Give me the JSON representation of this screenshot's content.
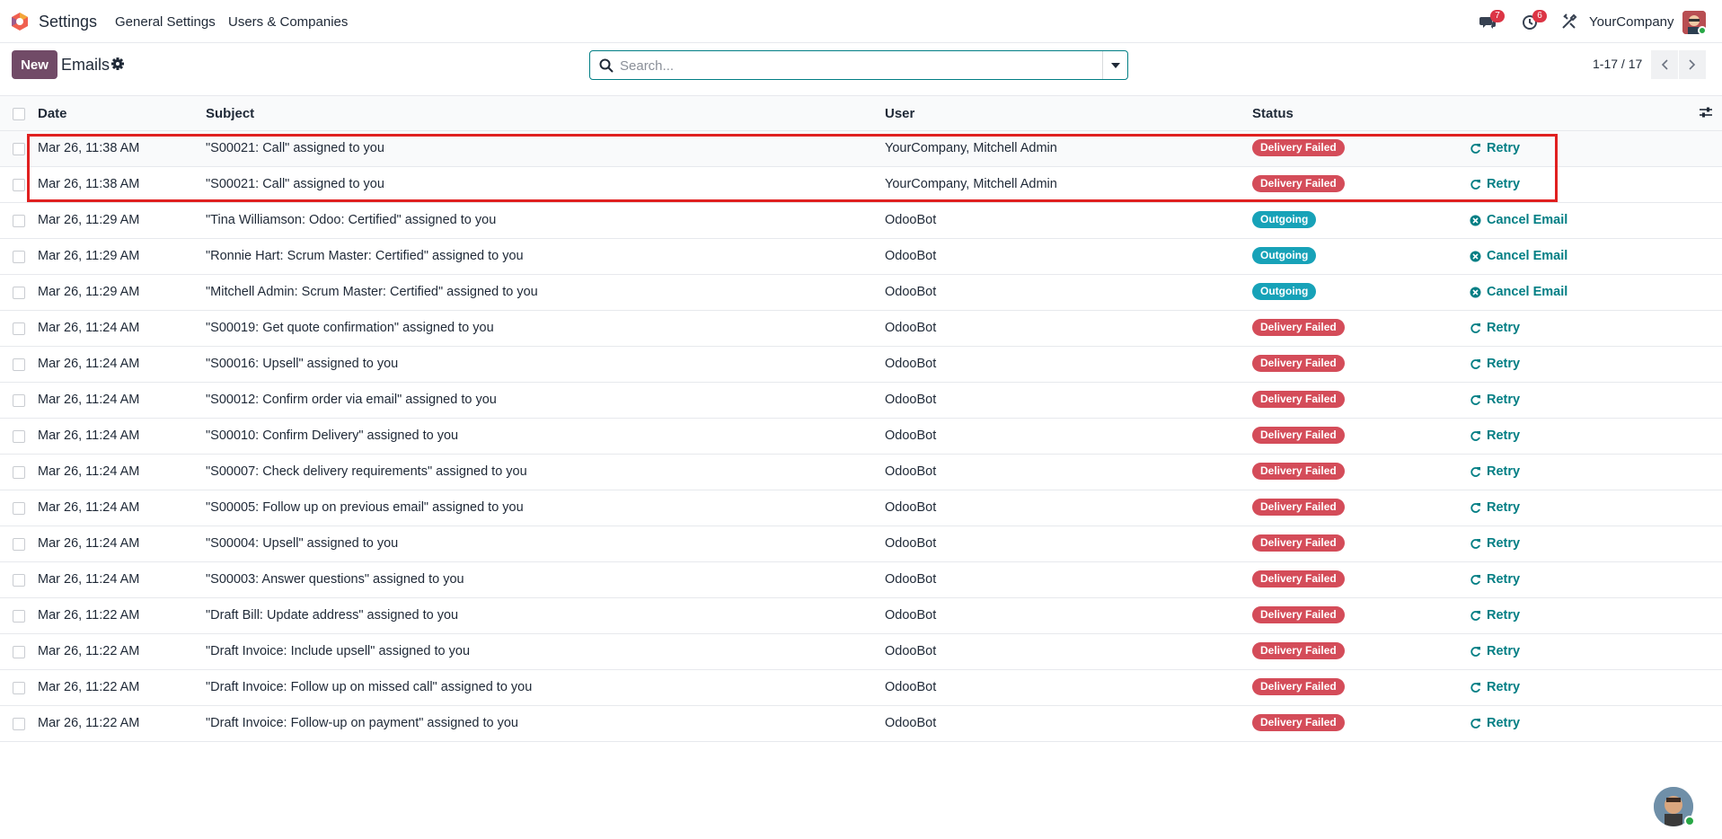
{
  "navbar": {
    "app_name": "Settings",
    "menu": [
      "General Settings",
      "Users & Companies"
    ],
    "messages_count": "7",
    "activities_count": "6",
    "company": "YourCompany"
  },
  "control": {
    "new_label": "New",
    "title": "Emails",
    "search_placeholder": "Search...",
    "pager": "1-17 / 17"
  },
  "table": {
    "headers": {
      "date": "Date",
      "subject": "Subject",
      "user": "User",
      "status": "Status"
    },
    "rows": [
      {
        "date": "Mar 26, 11:38 AM",
        "subject": "\"S00021: Call\" assigned to you",
        "user": "YourCompany, Mitchell Admin",
        "status": "Delivery Failed",
        "action": "Retry"
      },
      {
        "date": "Mar 26, 11:38 AM",
        "subject": "\"S00021: Call\" assigned to you",
        "user": "YourCompany, Mitchell Admin",
        "status": "Delivery Failed",
        "action": "Retry"
      },
      {
        "date": "Mar 26, 11:29 AM",
        "subject": "\"Tina Williamson: Odoo: Certified\" assigned to you",
        "user": "OdooBot",
        "status": "Outgoing",
        "action": "Cancel Email"
      },
      {
        "date": "Mar 26, 11:29 AM",
        "subject": "\"Ronnie Hart: Scrum Master: Certified\" assigned to you",
        "user": "OdooBot",
        "status": "Outgoing",
        "action": "Cancel Email"
      },
      {
        "date": "Mar 26, 11:29 AM",
        "subject": "\"Mitchell Admin: Scrum Master: Certified\" assigned to you",
        "user": "OdooBot",
        "status": "Outgoing",
        "action": "Cancel Email"
      },
      {
        "date": "Mar 26, 11:24 AM",
        "subject": "\"S00019: Get quote confirmation\" assigned to you",
        "user": "OdooBot",
        "status": "Delivery Failed",
        "action": "Retry"
      },
      {
        "date": "Mar 26, 11:24 AM",
        "subject": "\"S00016: Upsell\" assigned to you",
        "user": "OdooBot",
        "status": "Delivery Failed",
        "action": "Retry"
      },
      {
        "date": "Mar 26, 11:24 AM",
        "subject": "\"S00012: Confirm order via email\" assigned to you",
        "user": "OdooBot",
        "status": "Delivery Failed",
        "action": "Retry"
      },
      {
        "date": "Mar 26, 11:24 AM",
        "subject": "\"S00010: Confirm Delivery\" assigned to you",
        "user": "OdooBot",
        "status": "Delivery Failed",
        "action": "Retry"
      },
      {
        "date": "Mar 26, 11:24 AM",
        "subject": "\"S00007: Check delivery requirements\" assigned to you",
        "user": "OdooBot",
        "status": "Delivery Failed",
        "action": "Retry"
      },
      {
        "date": "Mar 26, 11:24 AM",
        "subject": "\"S00005: Follow up on previous email\" assigned to you",
        "user": "OdooBot",
        "status": "Delivery Failed",
        "action": "Retry"
      },
      {
        "date": "Mar 26, 11:24 AM",
        "subject": "\"S00004: Upsell\" assigned to you",
        "user": "OdooBot",
        "status": "Delivery Failed",
        "action": "Retry"
      },
      {
        "date": "Mar 26, 11:24 AM",
        "subject": "\"S00003: Answer questions\" assigned to you",
        "user": "OdooBot",
        "status": "Delivery Failed",
        "action": "Retry"
      },
      {
        "date": "Mar 26, 11:22 AM",
        "subject": "\"Draft Bill: Update address\" assigned to you",
        "user": "OdooBot",
        "status": "Delivery Failed",
        "action": "Retry"
      },
      {
        "date": "Mar 26, 11:22 AM",
        "subject": "\"Draft Invoice: Include upsell\" assigned to you",
        "user": "OdooBot",
        "status": "Delivery Failed",
        "action": "Retry"
      },
      {
        "date": "Mar 26, 11:22 AM",
        "subject": "\"Draft Invoice: Follow up on missed call\" assigned to you",
        "user": "OdooBot",
        "status": "Delivery Failed",
        "action": "Retry"
      },
      {
        "date": "Mar 26, 11:22 AM",
        "subject": "\"Draft Invoice: Follow-up on payment\" assigned to you",
        "user": "OdooBot",
        "status": "Delivery Failed",
        "action": "Retry"
      }
    ]
  },
  "colors": {
    "brand": "#714b67",
    "accent": "#017e84",
    "failed": "#d44c59",
    "outgoing": "#17a2b8",
    "highlight": "#e02020"
  }
}
